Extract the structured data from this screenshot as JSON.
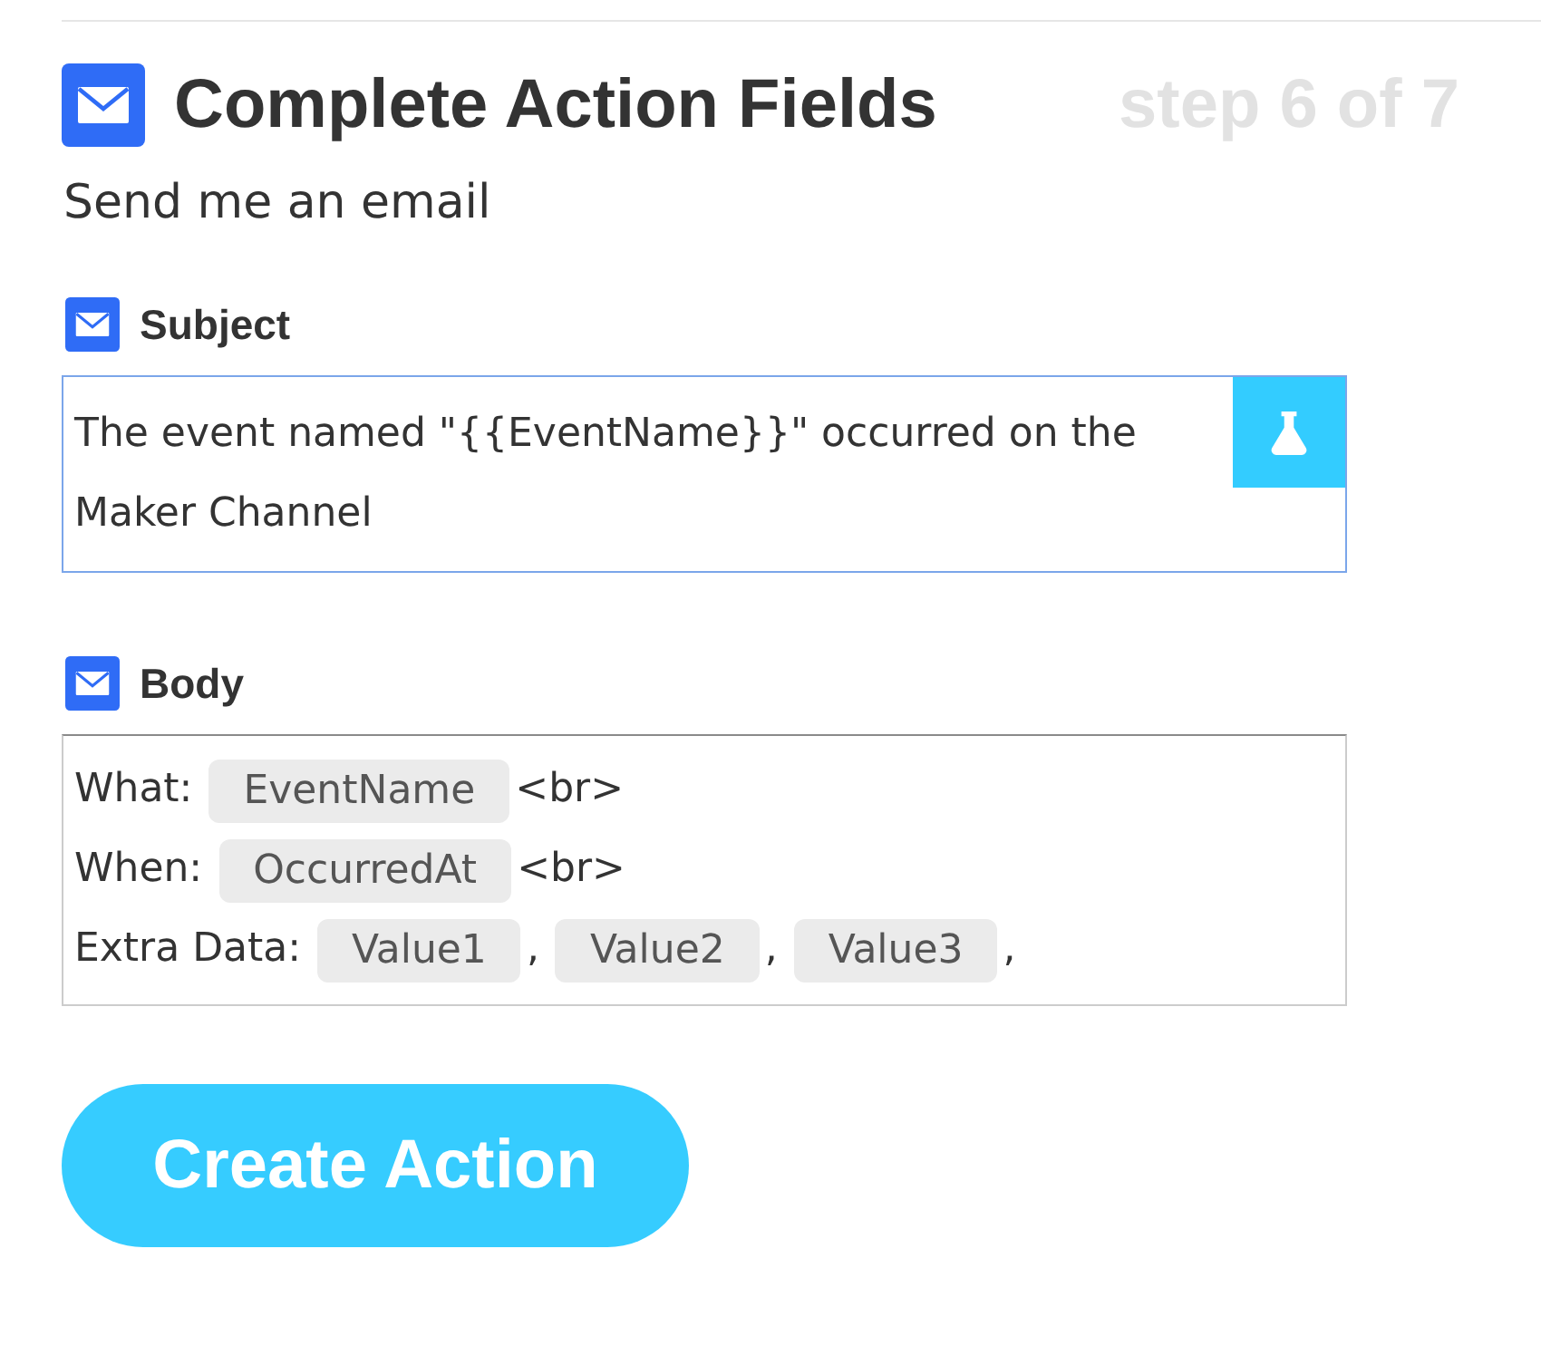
{
  "header": {
    "title": "Complete Action Fields",
    "step": "step 6 of 7",
    "subtitle": "Send me an email"
  },
  "fields": [
    {
      "label": "Subject",
      "kind": "text",
      "focused": true,
      "value": "The event named \"{{EventName}}\" occurred on the Maker Channel"
    },
    {
      "label": "Body",
      "kind": "rich",
      "focused": false,
      "lines": [
        {
          "parts": [
            {
              "kind": "text",
              "text": "What:"
            },
            {
              "kind": "token",
              "text": "EventName"
            },
            {
              "kind": "text",
              "text": "<br>"
            }
          ]
        },
        {
          "parts": [
            {
              "kind": "text",
              "text": "When:"
            },
            {
              "kind": "token",
              "text": "OccurredAt"
            },
            {
              "kind": "text",
              "text": "<br>"
            }
          ]
        },
        {
          "parts": [
            {
              "kind": "text",
              "text": "Extra Data:"
            },
            {
              "kind": "token",
              "text": "Value1"
            },
            {
              "kind": "text",
              "text": ","
            },
            {
              "kind": "token",
              "text": "Value2"
            },
            {
              "kind": "text",
              "text": ","
            },
            {
              "kind": "token",
              "text": "Value3"
            },
            {
              "kind": "text",
              "text": ","
            }
          ]
        }
      ]
    }
  ],
  "submit_button": {
    "label": "Create Action"
  }
}
